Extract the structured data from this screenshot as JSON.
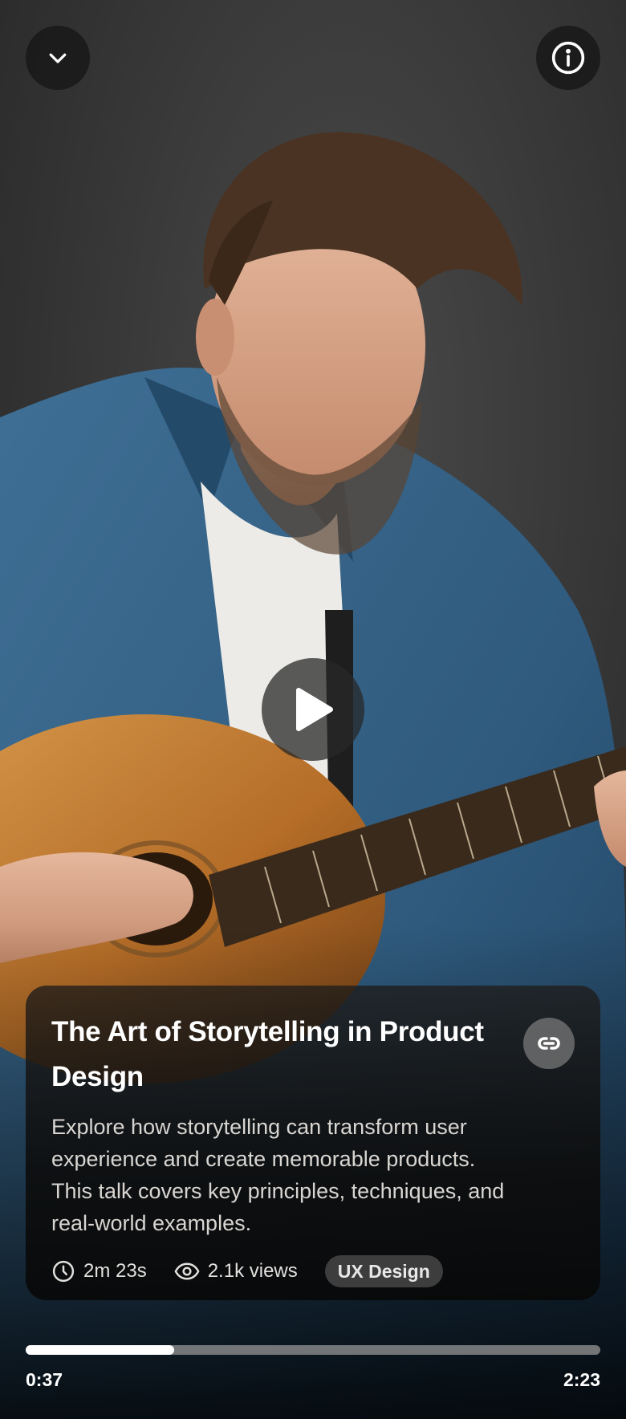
{
  "player": {
    "title": "The Art of Storytelling in Product Design",
    "description": "Explore how storytelling can transform user experience and create memorable products. This talk covers key principles, techniques, and real-world examples.",
    "duration_text": "2m 23s",
    "views_text": "2.1k views",
    "tag": "UX Design",
    "current_time": "0:37",
    "total_time": "2:23",
    "progress_fraction": 0.2587
  },
  "icons": {
    "collapse": "chevron-down-icon",
    "info": "info-icon",
    "play": "play-icon",
    "link": "link-icon",
    "clock": "clock-icon",
    "views": "eye-icon"
  },
  "colors": {
    "progress_fill": "#ffffff",
    "progress_track": "#969696",
    "tag_background": "#3d3d3d"
  }
}
